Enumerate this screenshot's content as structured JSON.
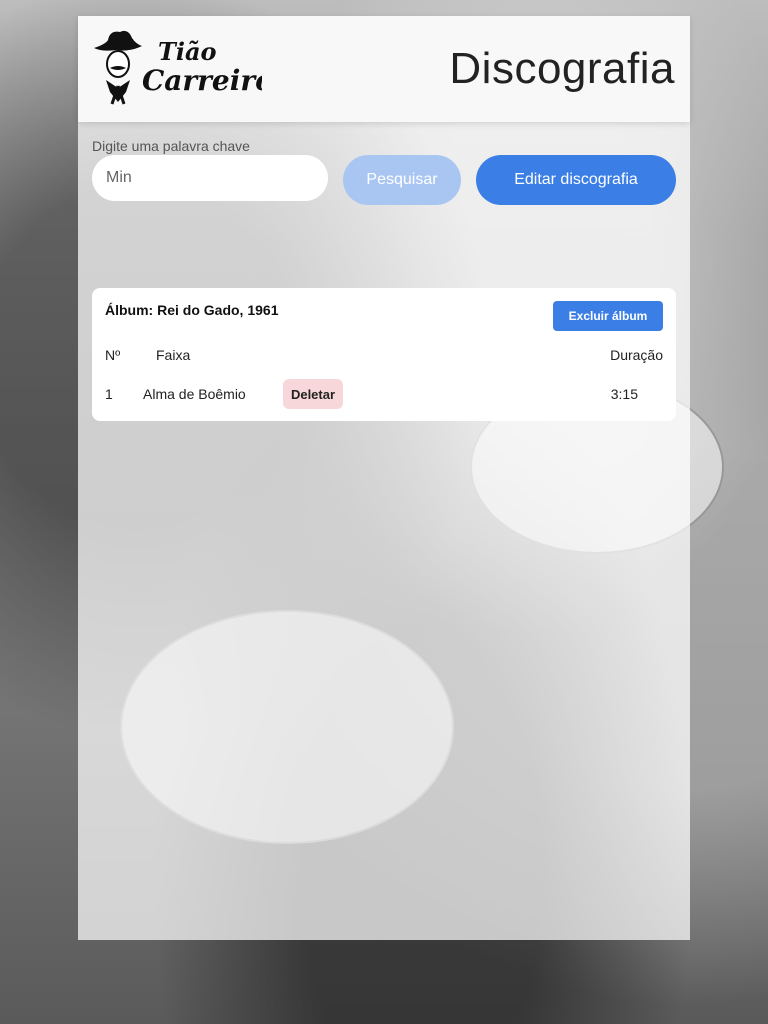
{
  "header": {
    "logo_text_line1": "Tião",
    "logo_text_line2": "Carreiro",
    "title": "Discografia"
  },
  "search": {
    "label": "Digite uma palavra chave",
    "value": "Min",
    "placeholder": "",
    "button_label": "Pesquisar"
  },
  "edit_button_label": "Editar discografia",
  "album": {
    "title": "Álbum: Rei do Gado, 1961",
    "delete_label": "Excluir álbum",
    "columns": [
      "Nº",
      "Faixa",
      "Duração"
    ],
    "tracks": [
      {
        "number": "1",
        "name": "Alma de Boêmio",
        "delete_label": "Deletar",
        "duration": "3:15"
      }
    ]
  },
  "colors": {
    "primary": "#3b7fe6",
    "primary_disabled": "#a9c6f3",
    "danger_light": "#f8d7da"
  }
}
